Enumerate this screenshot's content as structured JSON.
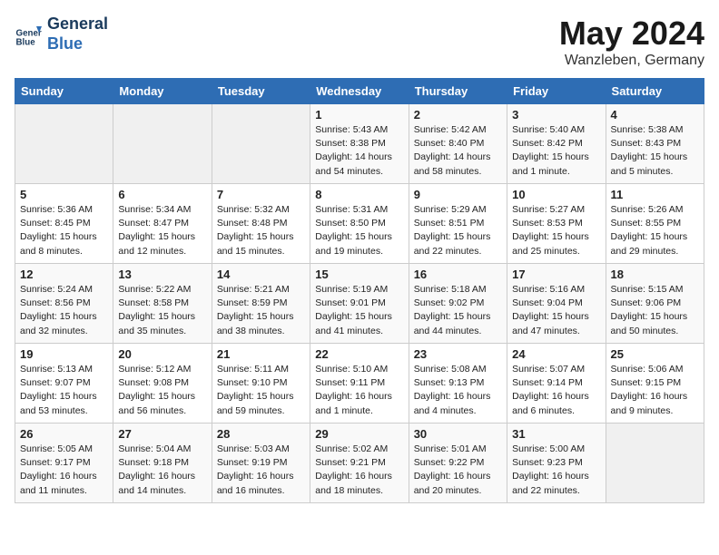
{
  "header": {
    "logo_line1": "General",
    "logo_line2": "Blue",
    "month": "May 2024",
    "location": "Wanzleben, Germany"
  },
  "weekdays": [
    "Sunday",
    "Monday",
    "Tuesday",
    "Wednesday",
    "Thursday",
    "Friday",
    "Saturday"
  ],
  "weeks": [
    [
      {
        "day": "",
        "info": ""
      },
      {
        "day": "",
        "info": ""
      },
      {
        "day": "",
        "info": ""
      },
      {
        "day": "1",
        "info": "Sunrise: 5:43 AM\nSunset: 8:38 PM\nDaylight: 14 hours\nand 54 minutes."
      },
      {
        "day": "2",
        "info": "Sunrise: 5:42 AM\nSunset: 8:40 PM\nDaylight: 14 hours\nand 58 minutes."
      },
      {
        "day": "3",
        "info": "Sunrise: 5:40 AM\nSunset: 8:42 PM\nDaylight: 15 hours\nand 1 minute."
      },
      {
        "day": "4",
        "info": "Sunrise: 5:38 AM\nSunset: 8:43 PM\nDaylight: 15 hours\nand 5 minutes."
      }
    ],
    [
      {
        "day": "5",
        "info": "Sunrise: 5:36 AM\nSunset: 8:45 PM\nDaylight: 15 hours\nand 8 minutes."
      },
      {
        "day": "6",
        "info": "Sunrise: 5:34 AM\nSunset: 8:47 PM\nDaylight: 15 hours\nand 12 minutes."
      },
      {
        "day": "7",
        "info": "Sunrise: 5:32 AM\nSunset: 8:48 PM\nDaylight: 15 hours\nand 15 minutes."
      },
      {
        "day": "8",
        "info": "Sunrise: 5:31 AM\nSunset: 8:50 PM\nDaylight: 15 hours\nand 19 minutes."
      },
      {
        "day": "9",
        "info": "Sunrise: 5:29 AM\nSunset: 8:51 PM\nDaylight: 15 hours\nand 22 minutes."
      },
      {
        "day": "10",
        "info": "Sunrise: 5:27 AM\nSunset: 8:53 PM\nDaylight: 15 hours\nand 25 minutes."
      },
      {
        "day": "11",
        "info": "Sunrise: 5:26 AM\nSunset: 8:55 PM\nDaylight: 15 hours\nand 29 minutes."
      }
    ],
    [
      {
        "day": "12",
        "info": "Sunrise: 5:24 AM\nSunset: 8:56 PM\nDaylight: 15 hours\nand 32 minutes."
      },
      {
        "day": "13",
        "info": "Sunrise: 5:22 AM\nSunset: 8:58 PM\nDaylight: 15 hours\nand 35 minutes."
      },
      {
        "day": "14",
        "info": "Sunrise: 5:21 AM\nSunset: 8:59 PM\nDaylight: 15 hours\nand 38 minutes."
      },
      {
        "day": "15",
        "info": "Sunrise: 5:19 AM\nSunset: 9:01 PM\nDaylight: 15 hours\nand 41 minutes."
      },
      {
        "day": "16",
        "info": "Sunrise: 5:18 AM\nSunset: 9:02 PM\nDaylight: 15 hours\nand 44 minutes."
      },
      {
        "day": "17",
        "info": "Sunrise: 5:16 AM\nSunset: 9:04 PM\nDaylight: 15 hours\nand 47 minutes."
      },
      {
        "day": "18",
        "info": "Sunrise: 5:15 AM\nSunset: 9:06 PM\nDaylight: 15 hours\nand 50 minutes."
      }
    ],
    [
      {
        "day": "19",
        "info": "Sunrise: 5:13 AM\nSunset: 9:07 PM\nDaylight: 15 hours\nand 53 minutes."
      },
      {
        "day": "20",
        "info": "Sunrise: 5:12 AM\nSunset: 9:08 PM\nDaylight: 15 hours\nand 56 minutes."
      },
      {
        "day": "21",
        "info": "Sunrise: 5:11 AM\nSunset: 9:10 PM\nDaylight: 15 hours\nand 59 minutes."
      },
      {
        "day": "22",
        "info": "Sunrise: 5:10 AM\nSunset: 9:11 PM\nDaylight: 16 hours\nand 1 minute."
      },
      {
        "day": "23",
        "info": "Sunrise: 5:08 AM\nSunset: 9:13 PM\nDaylight: 16 hours\nand 4 minutes."
      },
      {
        "day": "24",
        "info": "Sunrise: 5:07 AM\nSunset: 9:14 PM\nDaylight: 16 hours\nand 6 minutes."
      },
      {
        "day": "25",
        "info": "Sunrise: 5:06 AM\nSunset: 9:15 PM\nDaylight: 16 hours\nand 9 minutes."
      }
    ],
    [
      {
        "day": "26",
        "info": "Sunrise: 5:05 AM\nSunset: 9:17 PM\nDaylight: 16 hours\nand 11 minutes."
      },
      {
        "day": "27",
        "info": "Sunrise: 5:04 AM\nSunset: 9:18 PM\nDaylight: 16 hours\nand 14 minutes."
      },
      {
        "day": "28",
        "info": "Sunrise: 5:03 AM\nSunset: 9:19 PM\nDaylight: 16 hours\nand 16 minutes."
      },
      {
        "day": "29",
        "info": "Sunrise: 5:02 AM\nSunset: 9:21 PM\nDaylight: 16 hours\nand 18 minutes."
      },
      {
        "day": "30",
        "info": "Sunrise: 5:01 AM\nSunset: 9:22 PM\nDaylight: 16 hours\nand 20 minutes."
      },
      {
        "day": "31",
        "info": "Sunrise: 5:00 AM\nSunset: 9:23 PM\nDaylight: 16 hours\nand 22 minutes."
      },
      {
        "day": "",
        "info": ""
      }
    ]
  ]
}
